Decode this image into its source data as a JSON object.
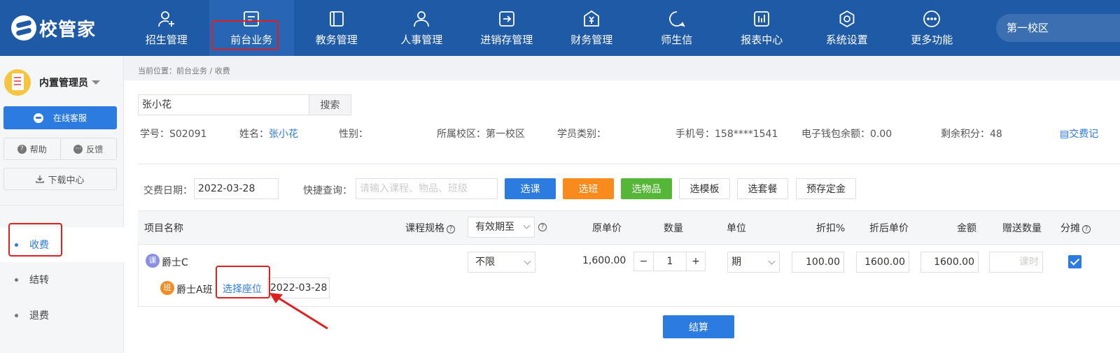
{
  "brand": {
    "name": "校管家"
  },
  "nav": [
    {
      "label": "招生管理",
      "icon": "person-plus-icon"
    },
    {
      "label": "前台业务",
      "icon": "front-desk-icon"
    },
    {
      "label": "教务管理",
      "icon": "book-icon"
    },
    {
      "label": "人事管理",
      "icon": "person-icon"
    },
    {
      "label": "进销存管理",
      "icon": "inventory-icon"
    },
    {
      "label": "财务管理",
      "icon": "finance-icon"
    },
    {
      "label": "师生信",
      "icon": "chat-icon"
    },
    {
      "label": "报表中心",
      "icon": "report-icon"
    },
    {
      "label": "系统设置",
      "icon": "settings-icon"
    },
    {
      "label": "更多功能",
      "icon": "more-icon"
    }
  ],
  "campus": "第一校区",
  "sidebar": {
    "user": "内置管理员",
    "online_service": "在线客服",
    "help": "帮助",
    "feedback": "反馈",
    "download": "下载中心",
    "menu": [
      "收费",
      "结转",
      "退费"
    ]
  },
  "breadcrumb": "当前位置：前台业务 / 收费",
  "search": {
    "value": "张小花",
    "button": "搜索"
  },
  "student": {
    "id_label": "学号：",
    "id": "S02091",
    "name_label": "姓名：",
    "name": "张小花",
    "gender_label": "性别：",
    "campus_label": "所属校区：",
    "campus": "第一校区",
    "type_label": "学员类别：",
    "phone_label": "手机号：",
    "phone": "158****1541",
    "wallet_label": "电子钱包余额：",
    "wallet": "0.00",
    "points_label": "剩余积分：",
    "points": "48",
    "record_link": "交费记"
  },
  "toolbar": {
    "date_label": "交费日期：",
    "date": "2022-03-28",
    "quick_label": "快捷查询：",
    "quick_placeholder": "请输入课程、物品、班级",
    "buttons": [
      "选课",
      "选班",
      "选物品",
      "选模板",
      "选套餐",
      "预存定金"
    ]
  },
  "table": {
    "headers": {
      "name": "项目名称",
      "spec": "课程规格",
      "validity": "有效期至",
      "orig_price": "原单价",
      "qty": "数量",
      "unit": "单位",
      "discount": "折扣%",
      "disc_price": "折后单价",
      "amount": "金额",
      "gift": "赠送数量",
      "split": "分摊"
    },
    "row": {
      "badge_course": "课",
      "course": "爵士C",
      "validity": "不限",
      "orig_price": "1,600.00",
      "qty": "1",
      "unit": "期",
      "discount": "100.00",
      "disc_price": "1600.00",
      "amount": "1600.00",
      "gift_placeholder": "课时",
      "badge_class": "班",
      "class_name": "爵士A班",
      "seat_link": "选择座位",
      "class_date": "2022-03-28"
    }
  },
  "settle": "结算",
  "colors": {
    "nav_bg": "#1f5aa6",
    "primary": "#2b7be0",
    "orange": "#f98a1c",
    "green": "#55b637",
    "highlight": "#e02020"
  }
}
